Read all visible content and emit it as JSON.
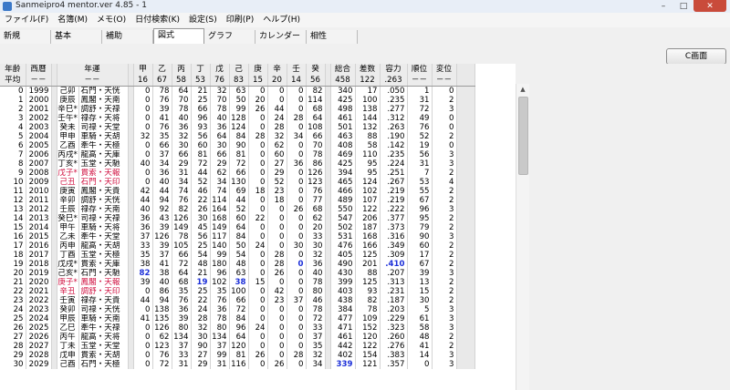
{
  "window": {
    "title": "Sanmeipro4 mentor.ver 4.85 - 1"
  },
  "menu": [
    "ファイル(F)",
    "名簿(M)",
    "メモ(O)",
    "日付検索(K)",
    "設定(S)",
    "印刷(P)",
    "ヘルプ(H)"
  ],
  "tabs": [
    "新規",
    "基本",
    "補助",
    "図式",
    "グラフ",
    "カレンダー",
    "相性"
  ],
  "active_tab": "図式",
  "c_button": "C画面",
  "header": {
    "row1": [
      "年齢",
      "西暦",
      "年運",
      "甲",
      "乙",
      "丙",
      "丁",
      "戊",
      "己",
      "庚",
      "辛",
      "壬",
      "癸",
      "総合",
      "差数",
      "容力",
      "順位",
      "変位"
    ],
    "row2": [
      "平均",
      "－－",
      "－－",
      "16",
      "67",
      "58",
      "53",
      "76",
      "83",
      "15",
      "20",
      "14",
      "56",
      "458",
      "122",
      ".263",
      "－－",
      "－－"
    ]
  },
  "rows": [
    {
      "age": "0",
      "year": "1999",
      "kz": "己卯",
      "un": "石門・天恍",
      "v": [
        "0",
        "78",
        "64",
        "21",
        "32",
        "63",
        "0",
        "0",
        "0",
        "82",
        "340",
        "17",
        ".050",
        "1",
        "0"
      ]
    },
    {
      "age": "1",
      "year": "2000",
      "kz": "庚辰",
      "un": "鳳閣・天南",
      "v": [
        "0",
        "76",
        "70",
        "25",
        "70",
        "50",
        "20",
        "0",
        "0",
        "114",
        "425",
        "100",
        ".235",
        "31",
        "2"
      ]
    },
    {
      "age": "2",
      "year": "2001",
      "kz": "辛巳*",
      "un": "調舒・天禄",
      "v": [
        "0",
        "39",
        "78",
        "66",
        "78",
        "99",
        "26",
        "44",
        "0",
        "68",
        "498",
        "138",
        ".277",
        "72",
        "3"
      ]
    },
    {
      "age": "3",
      "year": "2002",
      "kz": "壬午*",
      "un": "禄存・天将",
      "v": [
        "0",
        "41",
        "40",
        "96",
        "40",
        "128",
        "0",
        "24",
        "28",
        "64",
        "461",
        "144",
        ".312",
        "49",
        "0"
      ]
    },
    {
      "age": "4",
      "year": "2003",
      "kz": "癸未",
      "un": "司禄・天堂",
      "v": [
        "0",
        "76",
        "36",
        "93",
        "36",
        "124",
        "0",
        "28",
        "0",
        "108",
        "501",
        "132",
        ".263",
        "76",
        "0"
      ]
    },
    {
      "age": "5",
      "year": "2004",
      "kz": "甲申",
      "un": "車騎・天胡",
      "v": [
        "32",
        "35",
        "32",
        "56",
        "64",
        "84",
        "28",
        "32",
        "34",
        "66",
        "463",
        "88",
        ".190",
        "52",
        "2"
      ]
    },
    {
      "age": "6",
      "year": "2005",
      "kz": "乙酉",
      "un": "牽牛・天極",
      "v": [
        "0",
        "66",
        "30",
        "60",
        "30",
        "90",
        "0",
        "62",
        "0",
        "70",
        "408",
        "58",
        ".142",
        "19",
        "0"
      ]
    },
    {
      "age": "7",
      "year": "2006",
      "kz": "丙戌*",
      "un": "龍高・天庫",
      "v": [
        "0",
        "37",
        "66",
        "81",
        "66",
        "81",
        "0",
        "60",
        "0",
        "78",
        "469",
        "110",
        ".235",
        "56",
        "3"
      ]
    },
    {
      "age": "8",
      "year": "2007",
      "kz": "丁亥*",
      "un": "玉堂・天馳",
      "v": [
        "40",
        "34",
        "29",
        "72",
        "29",
        "72",
        "0",
        "27",
        "36",
        "86",
        "425",
        "95",
        ".224",
        "31",
        "3"
      ]
    },
    {
      "age": "9",
      "year": "2008",
      "kz": "戊子*",
      "un": "貫索・天報",
      "red": true,
      "v": [
        "0",
        "36",
        "31",
        "44",
        "62",
        "66",
        "0",
        "29",
        "0",
        "126",
        "394",
        "95",
        ".251",
        "7",
        "2"
      ]
    },
    {
      "age": "10",
      "year": "2009",
      "kz": "己丑",
      "un": "石門・天印",
      "red": true,
      "v": [
        "0",
        "40",
        "34",
        "52",
        "34",
        "130",
        "0",
        "52",
        "0",
        "123",
        "465",
        "124",
        ".267",
        "53",
        "4"
      ]
    },
    {
      "age": "11",
      "year": "2010",
      "kz": "庚寅",
      "un": "鳳閣・天貴",
      "v": [
        "42",
        "44",
        "74",
        "46",
        "74",
        "69",
        "18",
        "23",
        "0",
        "76",
        "466",
        "102",
        ".219",
        "55",
        "2"
      ]
    },
    {
      "age": "12",
      "year": "2011",
      "kz": "辛卯",
      "un": "調舒・天恍",
      "v": [
        "44",
        "94",
        "76",
        "22",
        "114",
        "44",
        "0",
        "18",
        "0",
        "77",
        "489",
        "107",
        ".219",
        "67",
        "2"
      ]
    },
    {
      "age": "13",
      "year": "2012",
      "kz": "壬辰",
      "un": "禄存・天南",
      "v": [
        "40",
        "92",
        "82",
        "26",
        "164",
        "52",
        "0",
        "0",
        "26",
        "68",
        "550",
        "122",
        ".222",
        "96",
        "3"
      ]
    },
    {
      "age": "14",
      "year": "2013",
      "kz": "癸巳*",
      "un": "司禄・天禄",
      "v": [
        "36",
        "43",
        "126",
        "30",
        "168",
        "60",
        "22",
        "0",
        "0",
        "62",
        "547",
        "206",
        ".377",
        "95",
        "2"
      ]
    },
    {
      "age": "15",
      "year": "2014",
      "kz": "甲午",
      "un": "車騎・天将",
      "v": [
        "36",
        "39",
        "149",
        "45",
        "149",
        "64",
        "0",
        "0",
        "0",
        "20",
        "502",
        "187",
        ".373",
        "79",
        "2"
      ]
    },
    {
      "age": "16",
      "year": "2015",
      "kz": "乙未",
      "un": "牽牛・天堂",
      "v": [
        "37",
        "126",
        "78",
        "56",
        "117",
        "84",
        "0",
        "0",
        "0",
        "33",
        "531",
        "168",
        ".316",
        "90",
        "3"
      ]
    },
    {
      "age": "17",
      "year": "2016",
      "kz": "丙申",
      "un": "龍高・天胡",
      "v": [
        "33",
        "39",
        "105",
        "25",
        "140",
        "50",
        "24",
        "0",
        "30",
        "30",
        "476",
        "166",
        ".349",
        "60",
        "2"
      ]
    },
    {
      "age": "18",
      "year": "2017",
      "kz": "丁酉",
      "un": "玉堂・天極",
      "v": [
        "35",
        "37",
        "66",
        "54",
        "99",
        "54",
        "0",
        "28",
        "0",
        "32",
        "405",
        "125",
        ".309",
        "17",
        "2"
      ]
    },
    {
      "age": "19",
      "year": "2018",
      "kz": "戊戌*",
      "un": "貫索・天庫",
      "v": [
        "38",
        "41",
        "72",
        "48",
        "180",
        "48",
        "0",
        "28",
        "0",
        "36",
        "490",
        "201",
        ".410",
        "67",
        "2"
      ],
      "bold": [
        8,
        12
      ]
    },
    {
      "age": "20",
      "year": "2019",
      "kz": "己亥*",
      "un": "石門・天馳",
      "v": [
        "82",
        "38",
        "64",
        "21",
        "96",
        "63",
        "0",
        "26",
        "0",
        "40",
        "430",
        "88",
        ".207",
        "39",
        "3"
      ],
      "bold": [
        0
      ]
    },
    {
      "age": "21",
      "year": "2020",
      "kz": "庚子*",
      "un": "鳳閣・天報",
      "red": true,
      "v": [
        "39",
        "40",
        "68",
        "19",
        "102",
        "38",
        "15",
        "0",
        "0",
        "78",
        "399",
        "125",
        ".313",
        "13",
        "2"
      ],
      "bold": [
        3,
        5
      ]
    },
    {
      "age": "22",
      "year": "2021",
      "kz": "辛丑",
      "un": "調舒・天印",
      "red": true,
      "v": [
        "0",
        "86",
        "35",
        "25",
        "35",
        "100",
        "0",
        "42",
        "0",
        "80",
        "403",
        "93",
        ".231",
        "15",
        "2"
      ]
    },
    {
      "age": "23",
      "year": "2022",
      "kz": "壬寅",
      "un": "禄存・天貴",
      "v": [
        "44",
        "94",
        "76",
        "22",
        "76",
        "66",
        "0",
        "23",
        "37",
        "46",
        "438",
        "82",
        ".187",
        "30",
        "2"
      ]
    },
    {
      "age": "24",
      "year": "2023",
      "kz": "癸卯",
      "un": "司禄・天恍",
      "v": [
        "0",
        "138",
        "36",
        "24",
        "36",
        "72",
        "0",
        "0",
        "0",
        "78",
        "384",
        "78",
        ".203",
        "5",
        "3"
      ]
    },
    {
      "age": "25",
      "year": "2024",
      "kz": "甲辰",
      "un": "車騎・天南",
      "v": [
        "41",
        "135",
        "39",
        "28",
        "78",
        "84",
        "0",
        "0",
        "0",
        "72",
        "477",
        "109",
        ".229",
        "61",
        "3"
      ]
    },
    {
      "age": "26",
      "year": "2025",
      "kz": "乙巳",
      "un": "牽牛・天禄",
      "v": [
        "0",
        "126",
        "80",
        "32",
        "80",
        "96",
        "24",
        "0",
        "0",
        "33",
        "471",
        "152",
        ".323",
        "58",
        "3"
      ]
    },
    {
      "age": "27",
      "year": "2026",
      "kz": "丙午",
      "un": "龍高・天将",
      "v": [
        "0",
        "62",
        "134",
        "30",
        "134",
        "64",
        "0",
        "0",
        "0",
        "37",
        "461",
        "120",
        ".260",
        "48",
        "2"
      ]
    },
    {
      "age": "28",
      "year": "2027",
      "kz": "丁未",
      "un": "玉堂・天堂",
      "v": [
        "0",
        "123",
        "37",
        "90",
        "37",
        "120",
        "0",
        "0",
        "0",
        "35",
        "442",
        "122",
        ".276",
        "41",
        "2"
      ]
    },
    {
      "age": "29",
      "year": "2028",
      "kz": "戊申",
      "un": "貫索・天胡",
      "v": [
        "0",
        "76",
        "33",
        "27",
        "99",
        "81",
        "26",
        "0",
        "28",
        "32",
        "402",
        "154",
        ".383",
        "14",
        "3"
      ]
    },
    {
      "age": "30",
      "year": "2029",
      "kz": "己酉",
      "un": "石門・天極",
      "v": [
        "0",
        "72",
        "31",
        "29",
        "31",
        "116",
        "0",
        "26",
        "0",
        "34",
        "339",
        "121",
        ".357",
        "0",
        "3"
      ],
      "bold": [
        10
      ]
    }
  ]
}
